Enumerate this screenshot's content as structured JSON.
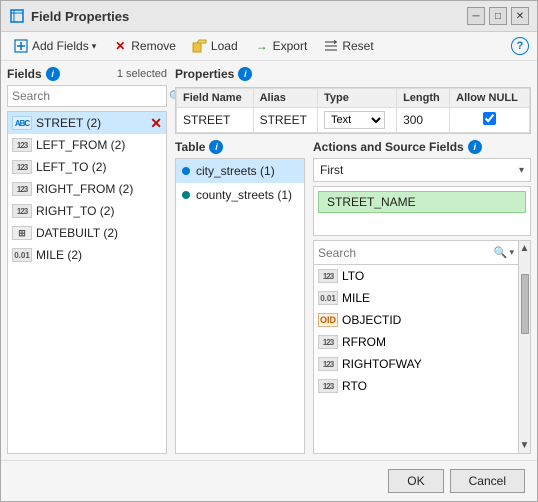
{
  "dialog": {
    "title": "Field Properties",
    "minimize_label": "─",
    "maximize_label": "□",
    "close_label": "✕"
  },
  "toolbar": {
    "add_fields_label": "Add Fields",
    "add_icon": "➕",
    "remove_label": "Remove",
    "remove_icon": "✕",
    "load_label": "Load",
    "load_icon": "📁",
    "export_label": "Export",
    "export_icon": "→",
    "reset_label": "Reset",
    "reset_icon": "↺",
    "help_label": "?"
  },
  "fields_panel": {
    "label": "Fields",
    "selected_count": "1 selected",
    "search_placeholder": "Search"
  },
  "fields_list": [
    {
      "type": "abc",
      "name": "STREET (2)",
      "selected": true,
      "removable": true
    },
    {
      "type": "num123",
      "name": "LEFT_FROM (2)",
      "selected": false
    },
    {
      "type": "num123",
      "name": "LEFT_TO (2)",
      "selected": false
    },
    {
      "type": "num123",
      "name": "RIGHT_FROM (2)",
      "selected": false
    },
    {
      "type": "num123",
      "name": "RIGHT_TO (2)",
      "selected": false
    },
    {
      "type": "grid",
      "name": "DATEBUILT (2)",
      "selected": false
    },
    {
      "type": "decimal",
      "name": "MILE (2)",
      "selected": false
    }
  ],
  "properties_panel": {
    "label": "Properties",
    "columns": [
      "Field Name",
      "Alias",
      "Type",
      "Length",
      "Allow NULL"
    ],
    "row": {
      "field_name": "STREET",
      "alias": "STREET",
      "type": "Text",
      "length": "300",
      "allow_null": true
    }
  },
  "table_panel": {
    "label": "Table",
    "tables": [
      {
        "name": "city_streets",
        "count": "(1)",
        "color": "blue"
      },
      {
        "name": "county_streets",
        "count": "(1)",
        "color": "teal"
      }
    ]
  },
  "actions_panel": {
    "label": "Actions and Source Fields",
    "first_option": "First",
    "source_chip": "STREET_NAME",
    "search_placeholder": "Search",
    "source_fields": [
      {
        "type": "num123",
        "name": "LTO"
      },
      {
        "type": "decimal",
        "name": "MILE"
      },
      {
        "type": "objectid",
        "name": "OBJECTID"
      },
      {
        "type": "num123",
        "name": "RFROM"
      },
      {
        "type": "num123",
        "name": "RIGHTOFWAY"
      },
      {
        "type": "num123",
        "name": "RTO"
      }
    ]
  },
  "footer": {
    "ok_label": "OK",
    "cancel_label": "Cancel"
  }
}
